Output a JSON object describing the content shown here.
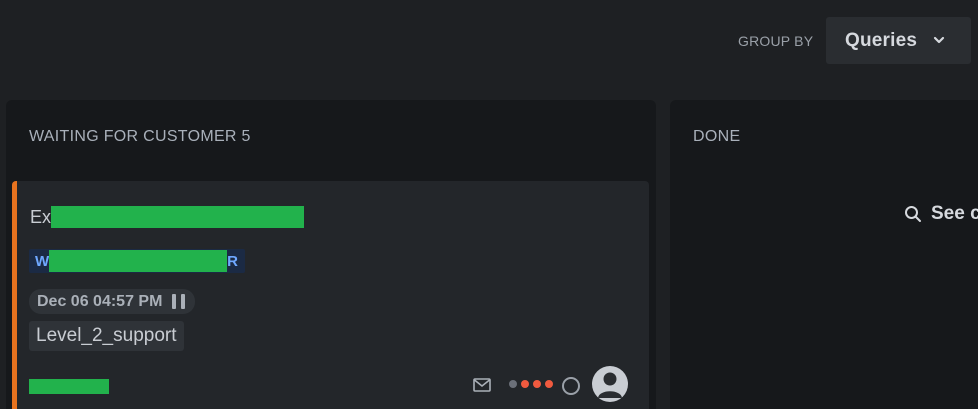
{
  "topbar": {
    "group_by_label": "GROUP BY",
    "group_by_value": "Queries"
  },
  "columns": [
    {
      "title": "WAITING FOR CUSTOMER 5",
      "cards": [
        {
          "title_prefix": "Ex",
          "tag_prefix": "W",
          "tag_suffix": "R",
          "date": "Dec 06 04:57 PM",
          "queue": "Level_2_support",
          "priority_dots_active": 3,
          "priority_dots_total": 4
        }
      ]
    },
    {
      "title": "DONE",
      "see_all_label": "See c"
    }
  ],
  "colors": {
    "accent_orange": "#e8731f",
    "priority_red": "#f05a3f",
    "tag_blue": "#6fa8ff",
    "redaction_green": "#22b24c"
  },
  "icons": [
    "chevron-down-icon",
    "search-icon",
    "mail-icon",
    "pause-icon",
    "avatar-icon",
    "status-ring-icon"
  ]
}
